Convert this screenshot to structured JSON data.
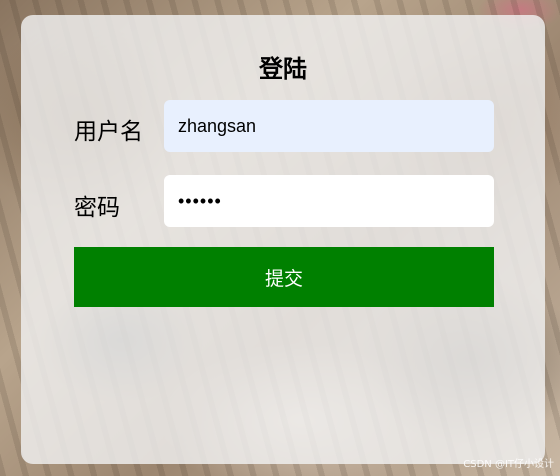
{
  "form": {
    "title": "登陆",
    "username_label": "用户名",
    "username_value": "zhangsan",
    "password_label": "密码",
    "password_value": "123456",
    "submit_label": "提交"
  },
  "watermark": "CSDN @IT仔小设计",
  "colors": {
    "submit_bg": "#008000",
    "username_field_bg": "#e8f0fe",
    "card_bg": "rgba(240,240,240,0.82)"
  }
}
